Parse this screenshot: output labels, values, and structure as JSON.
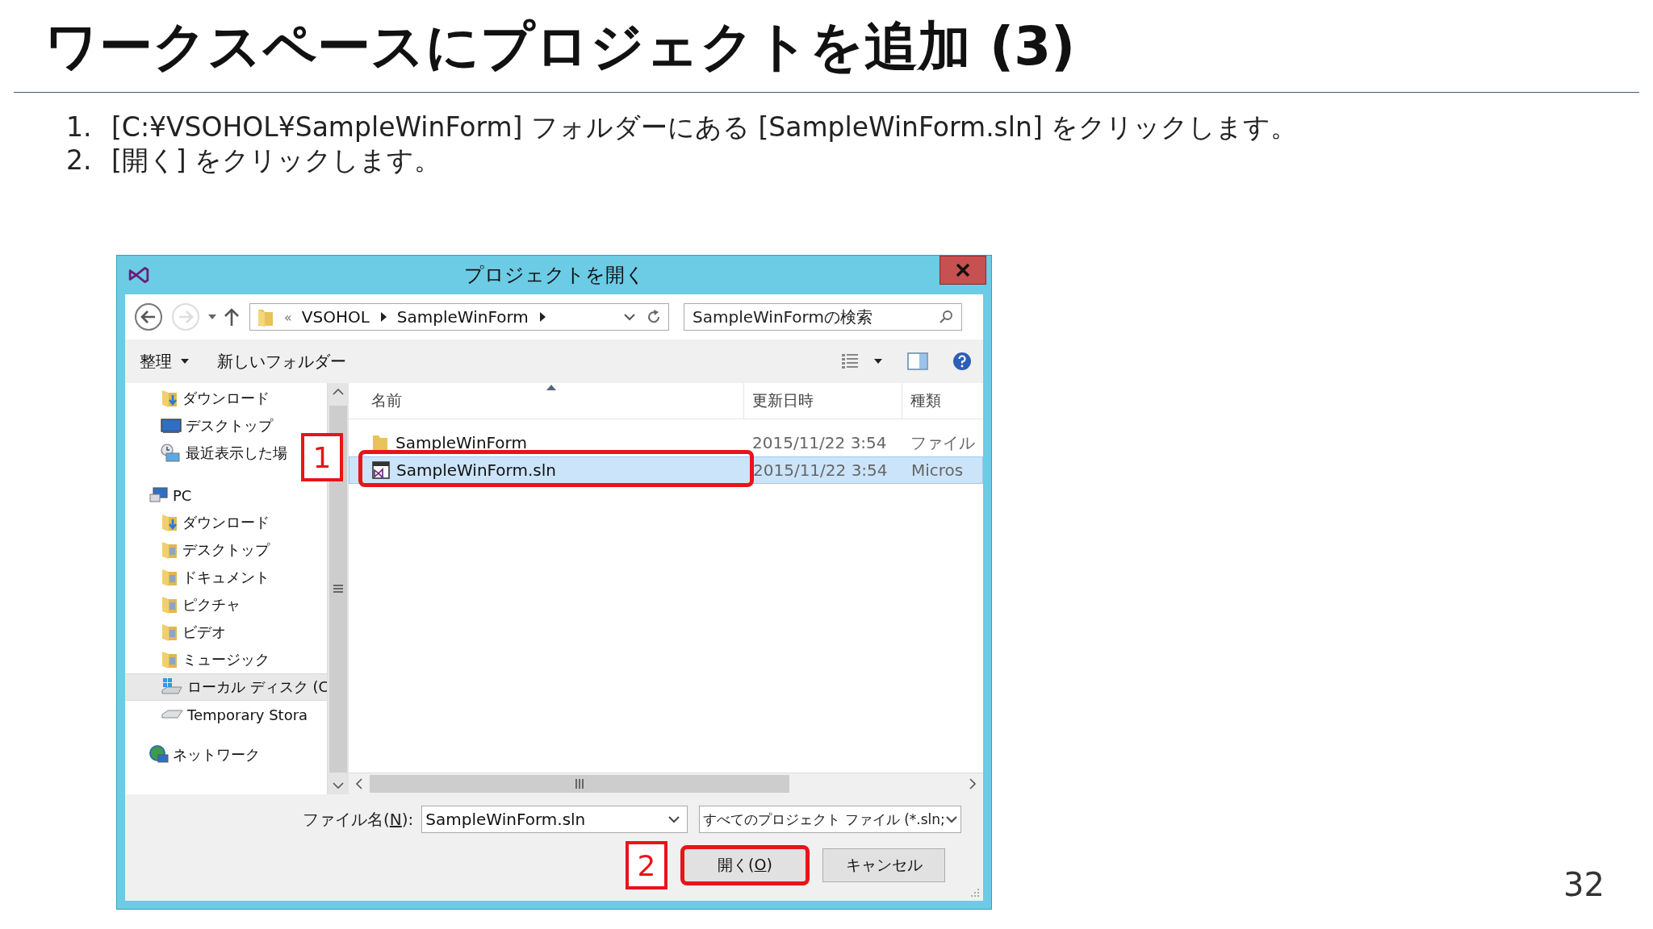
{
  "slide": {
    "title": "ワークスペースにプロジェクトを追加 (3)",
    "steps": [
      {
        "number": "1.",
        "text": "[C:¥VSOHOL¥SampleWinForm] フォルダーにある [SampleWinForm.sln] をクリックします。"
      },
      {
        "number": "2.",
        "text": "[開く] をクリックします。"
      }
    ],
    "page_number": "32"
  },
  "dialog": {
    "title": "プロジェクトを開く",
    "address": {
      "overflow": "«",
      "segments": [
        "VSOHOL",
        "SampleWinForm"
      ]
    },
    "search": {
      "placeholder": "SampleWinFormの検索"
    },
    "toolbar": {
      "organize": "整理",
      "new_folder": "新しいフォルダー"
    },
    "nav": {
      "favorites": [
        {
          "label": "ダウンロード",
          "kind": "download",
          "selected": false
        },
        {
          "label": "デスクトップ",
          "kind": "desktop",
          "selected": false
        },
        {
          "label": "最近表示した場",
          "kind": "recent",
          "selected": false
        }
      ],
      "tree": [
        {
          "label": "PC",
          "kind": "pc",
          "selected": false,
          "children": [
            {
              "label": "ダウンロード",
              "kind": "download",
              "selected": false
            },
            {
              "label": "デスクトップ",
              "kind": "folder",
              "selected": false
            },
            {
              "label": "ドキュメント",
              "kind": "folder",
              "selected": false
            },
            {
              "label": "ピクチャ",
              "kind": "folder",
              "selected": false
            },
            {
              "label": "ビデオ",
              "kind": "folder",
              "selected": false
            },
            {
              "label": "ミュージック",
              "kind": "folder",
              "selected": false
            },
            {
              "label": "ローカル ディスク (C",
              "kind": "drive",
              "selected": true
            },
            {
              "label": "Temporary Stora",
              "kind": "disk",
              "selected": false
            }
          ]
        },
        {
          "label": "ネットワーク",
          "kind": "network",
          "selected": false
        }
      ]
    },
    "columns": [
      "名前",
      "更新日時",
      "種類"
    ],
    "files": [
      {
        "name": "SampleWinForm",
        "modified": "2015/11/22 3:54",
        "type": "ファイル",
        "kind": "folder",
        "selected": false
      },
      {
        "name": "SampleWinForm.sln",
        "modified": "2015/11/22 3:54",
        "type": "Micros",
        "kind": "solution",
        "selected": true
      }
    ],
    "filename": {
      "label_before": "ファイル名(",
      "accesskey": "N",
      "label_after": "):",
      "value": "SampleWinForm.sln"
    },
    "filetype": "すべてのプロジェクト ファイル (*.sln;",
    "buttons": [
      {
        "label_before": "開く(",
        "accesskey": "O",
        "label_after": ")",
        "kind": "open"
      },
      {
        "label_before": "キャンセル",
        "kind": "cancel"
      }
    ],
    "callouts": [
      {
        "number": "1"
      },
      {
        "number": "2"
      }
    ]
  }
}
